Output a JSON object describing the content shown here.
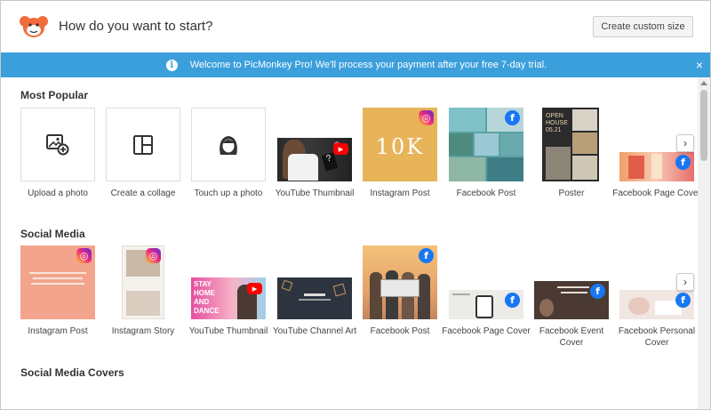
{
  "header": {
    "title": "How do you want to start?",
    "custom_size_label": "Create custom size",
    "logo_icon": "monkey-logo-icon"
  },
  "banner": {
    "text": "Welcome to PicMonkey Pro! We'll process your payment after your free 7-day trial.",
    "info_glyph": "i",
    "close_glyph": "×",
    "color": "#3b9fdc"
  },
  "sections": {
    "most_popular": {
      "title": "Most Popular",
      "items": [
        {
          "label": "Upload a photo",
          "icon": "image-add-icon"
        },
        {
          "label": "Create a collage",
          "icon": "collage-grid-icon"
        },
        {
          "label": "Touch up a photo",
          "icon": "face-icon"
        },
        {
          "label": "YouTube Thumbnail",
          "badge": "youtube"
        },
        {
          "label": "Instagram Post",
          "badge": "instagram",
          "image_text": "10K"
        },
        {
          "label": "Facebook Post",
          "badge": "facebook"
        },
        {
          "label": "Poster",
          "image_text": "OPEN HOUSE 05.21"
        },
        {
          "label": "Facebook Page Cover",
          "badge": "facebook"
        }
      ]
    },
    "social_media": {
      "title": "Social Media",
      "items": [
        {
          "label": "Instagram Post",
          "badge": "instagram"
        },
        {
          "label": "Instagram Story",
          "badge": "instagram"
        },
        {
          "label": "YouTube Thumbnail",
          "badge": "youtube",
          "image_text": "STAY HOME AND DANCE"
        },
        {
          "label": "YouTube Channel Art"
        },
        {
          "label": "Facebook Post",
          "badge": "facebook"
        },
        {
          "label": "Facebook Page Cover",
          "badge": "facebook"
        },
        {
          "label": "Facebook Event Cover",
          "badge": "facebook"
        },
        {
          "label": "Facebook Personal Cover",
          "badge": "facebook"
        }
      ]
    },
    "social_media_covers": {
      "title": "Social Media Covers"
    }
  },
  "next_glyph": "›",
  "colors": {
    "facebook": "#1877f2",
    "youtube": "#ff0000"
  }
}
